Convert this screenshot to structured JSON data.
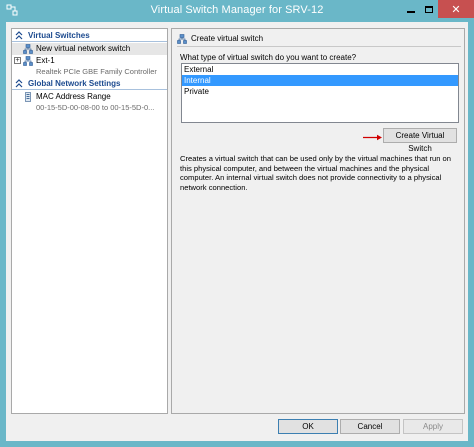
{
  "window": {
    "title": "Virtual Switch Manager for SRV-12",
    "minimize_label": "minimize",
    "maximize_label": "maximize",
    "close_glyph": "✕"
  },
  "sidebar": {
    "virtual_switches_header": "Virtual Switches",
    "global_header": "Global Network Settings",
    "items": [
      {
        "label": "New virtual network switch",
        "icon": "network-switch-icon",
        "selected": true
      },
      {
        "label": "Ext-1",
        "sublabel": "Realtek PCIe GBE Family Controller",
        "icon": "network-switch-icon",
        "expander": "+"
      },
      {
        "label": "MAC Address Range",
        "sublabel": "00-15-5D-00-08-00 to 00-15-5D-0...",
        "icon": "mac-range-icon"
      }
    ]
  },
  "panel": {
    "header": "Create virtual switch",
    "question": "What type of virtual switch do you want to create?",
    "options": [
      "External",
      "Internal",
      "Private"
    ],
    "selected_option": "Internal",
    "create_button": "Create Virtual Switch",
    "description": "Creates a virtual switch that can be used only by the virtual machines that run on this physical computer, and between the virtual machines and the physical computer. An internal virtual switch does not provide connectivity to a physical network connection."
  },
  "footer": {
    "ok": "OK",
    "cancel": "Cancel",
    "apply": "Apply"
  },
  "colors": {
    "titlebar": "#6ab7c8",
    "close": "#c75050",
    "selection": "#3399ff",
    "header_text": "#1c4a8f",
    "arrow": "#d00000"
  }
}
